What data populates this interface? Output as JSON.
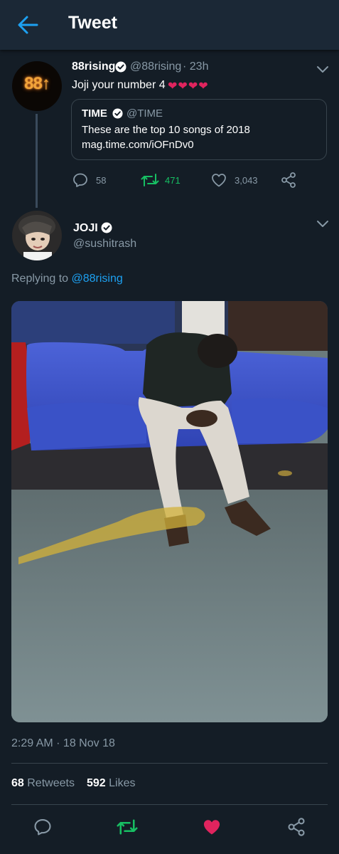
{
  "header": {
    "title": "Tweet"
  },
  "parent_tweet": {
    "avatar_text": "88↑",
    "name": "88rising",
    "handle": "@88rising",
    "time": "· 23h",
    "text": "Joji your number 4",
    "emoji": "❤❤❤❤",
    "quote": {
      "name": "TIME",
      "handle": "@TIME",
      "line1": "These are the top 10 songs of 2018",
      "line2": "mag.time.com/iOFnDv0"
    },
    "actions": {
      "replies": "58",
      "retweets": "471",
      "likes": "3,043"
    }
  },
  "main_tweet": {
    "name": "JOJI",
    "handle": "@sushitrash",
    "replying_prefix": "Replying to",
    "replying_handle": "@88rising",
    "timestamp": "2:29 AM · 18 Nov 18",
    "retweet_count": "68",
    "retweet_label": "Retweets",
    "like_count": "592",
    "like_label": "Likes"
  },
  "colors": {
    "background": "#141d26",
    "header": "#1b2836",
    "accent_blue": "#1da1f2",
    "retweet_green": "#17bf63",
    "like_red": "#e0245e",
    "secondary_text": "#8899a6"
  },
  "icons": [
    "back-arrow-icon",
    "verified-badge-icon",
    "chevron-down-icon",
    "reply-icon",
    "retweet-icon",
    "heart-icon",
    "share-icon"
  ]
}
